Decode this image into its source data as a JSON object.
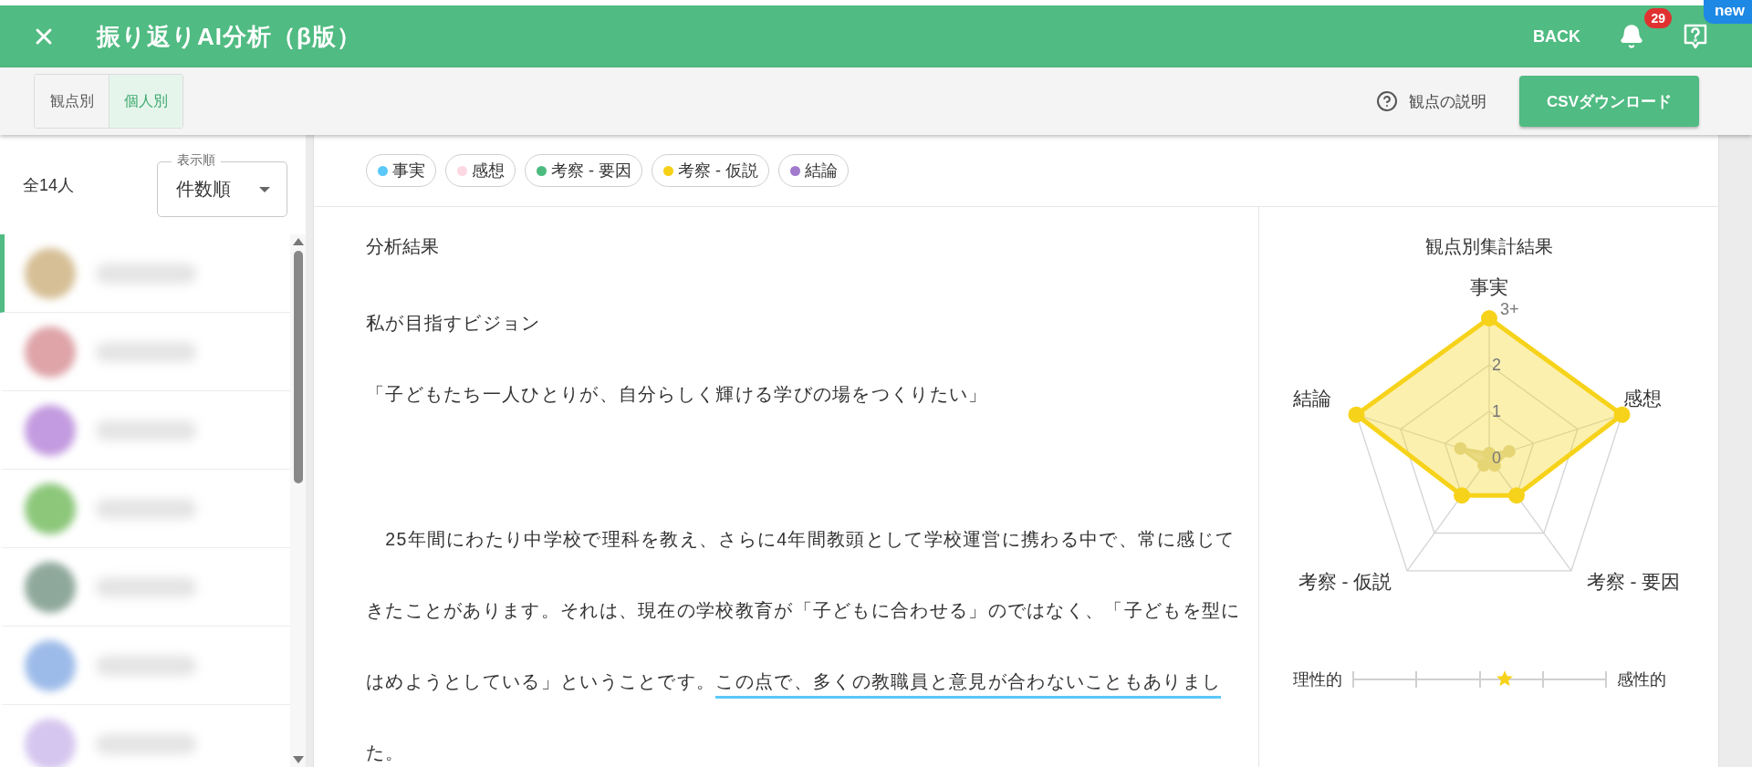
{
  "header": {
    "title": "振り返りAI分析（β版）",
    "back": "BACK",
    "notification_count": "29",
    "help_badge": "new"
  },
  "toolbar": {
    "view_tabs": [
      {
        "label": "観点別",
        "selected": false
      },
      {
        "label": "個人別",
        "selected": true
      }
    ],
    "help_link": "観点の説明",
    "download_button": "CSVダウンロード"
  },
  "sidebar": {
    "count": "全14人",
    "sort": {
      "label": "表示順",
      "value": "件数順"
    },
    "students": [
      {
        "color": "#d6bf96",
        "selected": true
      },
      {
        "color": "#dea4a8",
        "selected": false
      },
      {
        "color": "#c39be0",
        "selected": false
      },
      {
        "color": "#8cc77a",
        "selected": false
      },
      {
        "color": "#8fa89c",
        "selected": false
      },
      {
        "color": "#9dbbe9",
        "selected": false
      },
      {
        "color": "#d5c6ef",
        "selected": false
      }
    ]
  },
  "legend": [
    {
      "label": "事実",
      "color": "#5ac8fa"
    },
    {
      "label": "感想",
      "color": "#fcd9e2"
    },
    {
      "label": "考察 - 要因",
      "color": "#4cbb7f"
    },
    {
      "label": "考察 - 仮説",
      "color": "#f5d016"
    },
    {
      "label": "結論",
      "color": "#a07acc"
    }
  ],
  "analysis": {
    "title": "分析結果",
    "paragraphs": [
      {
        "lines": [
          [
            {
              "text": "私が目指すビジョン"
            }
          ]
        ]
      },
      {
        "lines": [
          [
            {
              "text": "「子どもたち一人ひとりが、自分らしく輝ける学びの場をつくりたい」"
            }
          ]
        ]
      },
      {
        "lines": [
          [
            {
              "text": "　25年間にわたり中学校で理科を教え、さらに4年間教頭として学校運営に携わる中で、常に感じて"
            }
          ],
          [
            {
              "text": "きたことがあります。それは、現在の学校教育が「子どもに合わせる」のではなく、「子どもを型に"
            }
          ],
          [
            {
              "text": "はめようとしている」ということです。"
            },
            {
              "text": "この点で、多くの教職員と意見が合わないこともありまし",
              "color": "#5ac8fa"
            }
          ],
          [
            {
              "text": "た。"
            }
          ]
        ]
      }
    ]
  },
  "summary": {
    "title": "観点別集計結果",
    "chart_data": {
      "type": "radar",
      "categories": [
        "事実",
        "感想",
        "考察 - 要因",
        "考察 - 仮説",
        "結論"
      ],
      "series": [
        {
          "color": "#f6d31a",
          "values": [
            3,
            3,
            1,
            1,
            3
          ]
        },
        {
          "color": "#ddd6a6",
          "values": [
            0.1,
            0.45,
            0.2,
            0.2,
            0.65
          ]
        }
      ],
      "ylim": [
        0,
        3
      ],
      "yticks": [
        0,
        1,
        2,
        {
          "value": 3,
          "label": "3+"
        }
      ]
    },
    "scale": {
      "left": "理性的",
      "right": "感性的",
      "level": 0.6
    }
  }
}
